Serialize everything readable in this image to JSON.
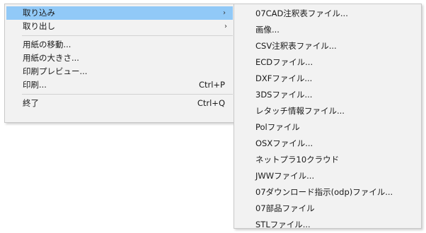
{
  "main_menu": {
    "items": [
      {
        "label": "取り込み",
        "arrow": "›"
      },
      {
        "label": "取り出し",
        "arrow": "›"
      },
      {
        "label": "用紙の移動..."
      },
      {
        "label": "用紙の大きさ..."
      },
      {
        "label": "印刷プレビュー..."
      },
      {
        "label": "印刷...",
        "shortcut": "Ctrl+P"
      },
      {
        "label": "終了",
        "shortcut": "Ctrl+Q"
      }
    ]
  },
  "submenu": {
    "items": [
      "07CAD注釈表ファイル...",
      "画像...",
      "CSV注釈表ファイル...",
      "ECDファイル...",
      "DXFファイル...",
      "3DSファイル...",
      "レタッチ情報ファイル...",
      "Polファイル",
      "OSXファイル...",
      "ネットプラ10クラウド",
      "JWWファイル...",
      "07ダウンロード指示(odp)ファイル...",
      "07部品ファイル",
      "STLファイル..."
    ]
  },
  "colors": {
    "menu_bg": "#f2f2f2",
    "highlight": "#91c9f7",
    "border": "#c8c8c8"
  }
}
